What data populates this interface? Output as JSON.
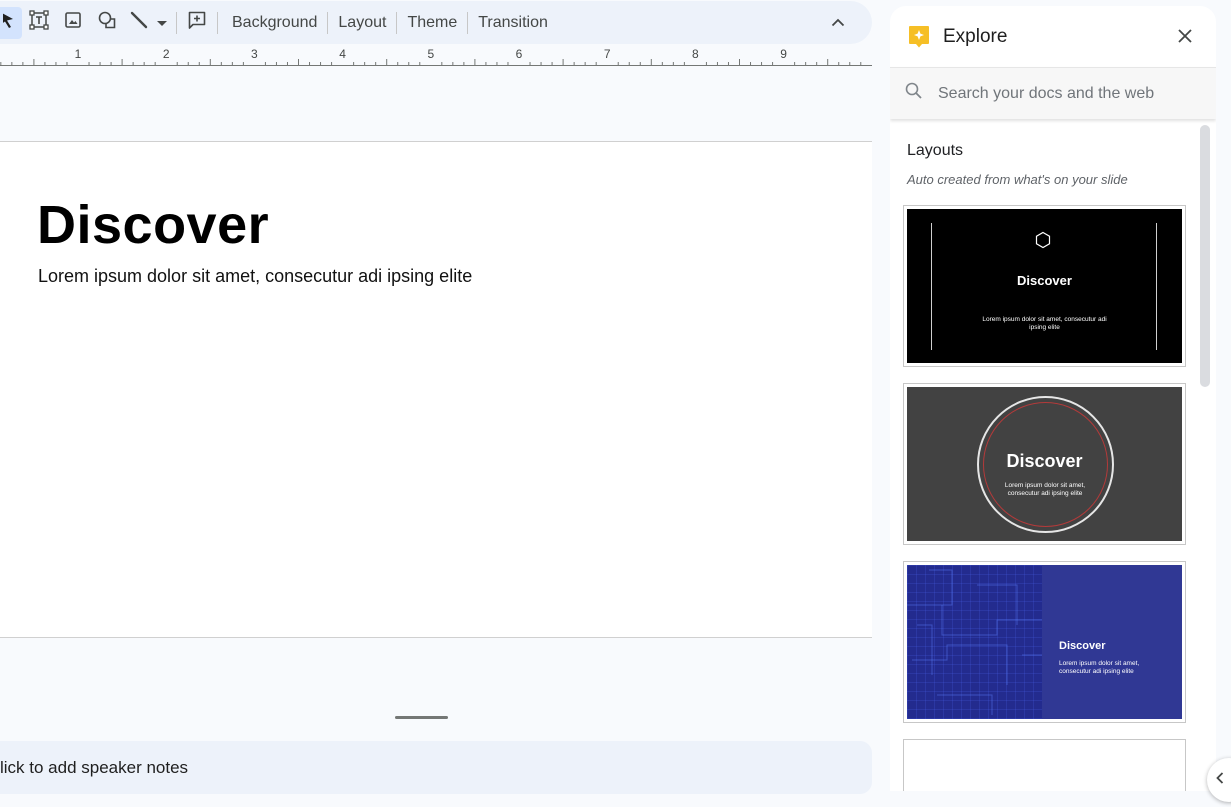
{
  "toolbar": {
    "tools": [
      {
        "name": "select-tool",
        "icon": "cursor-icon"
      },
      {
        "name": "textbox-tool",
        "icon": "textbox-icon"
      },
      {
        "name": "image-tool",
        "icon": "image-icon"
      },
      {
        "name": "shape-tool",
        "icon": "shape-icon"
      },
      {
        "name": "line-tool",
        "icon": "line-icon"
      },
      {
        "name": "comment-tool",
        "icon": "add-comment-icon"
      }
    ],
    "background_label": "Background",
    "layout_label": "Layout",
    "theme_label": "Theme",
    "transition_label": "Transition",
    "collapse_icon": "chevron-up-icon"
  },
  "ruler": {
    "labels": [
      "1",
      "2",
      "3",
      "4",
      "5",
      "6",
      "7",
      "8",
      "9"
    ]
  },
  "slide": {
    "title": "Discover",
    "subtitle": "Lorem ipsum dolor sit amet, consecutur adi ipsing elite"
  },
  "notes": {
    "placeholder": "lick to add speaker notes"
  },
  "explore": {
    "title": "Explore",
    "search_placeholder": "Search your docs and the web",
    "section_title": "Layouts",
    "section_subtitle": "Auto created from what's on your slide",
    "layouts": [
      {
        "style": "black-hexagon",
        "title": "Discover",
        "subtitle": "Lorem ipsum dolor sit amet, consecutur adi ipsing elite",
        "background": "#000000"
      },
      {
        "style": "gray-circle",
        "title": "Discover",
        "subtitle": "Lorem ipsum dolor sit amet, consecutur adi ipsing elite",
        "background": "#424242",
        "accent": "#b33a3a"
      },
      {
        "style": "blue-grid",
        "title": "Discover",
        "subtitle": "Lorem ipsum dolor sit amet, consecutur adi ipsing elite",
        "background": "#303894"
      },
      {
        "style": "blank",
        "title": "",
        "subtitle": "",
        "background": "#ffffff"
      }
    ]
  },
  "colors": {
    "toolbar_bg": "#edf2fa",
    "page_bg": "#f8fafd",
    "explore_logo": "#f6bf26",
    "select_active": "#d3e3fd"
  }
}
